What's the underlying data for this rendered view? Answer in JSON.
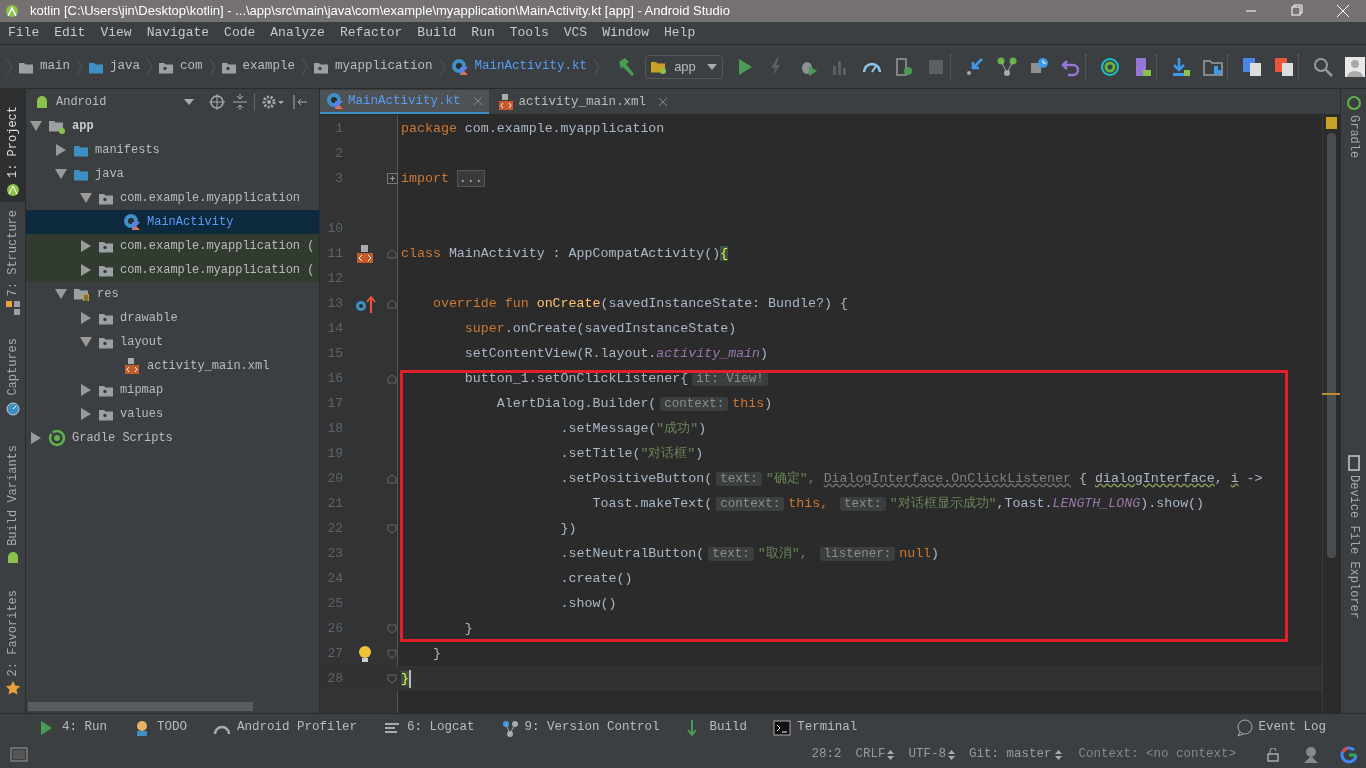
{
  "window": {
    "title": "kotlin [C:\\Users\\jin\\Desktop\\kotlin] - ...\\app\\src\\main\\java\\com\\example\\myapplication\\MainActivity.kt [app] - Android Studio"
  },
  "menu": [
    "File",
    "Edit",
    "View",
    "Navigate",
    "Code",
    "Analyze",
    "Refactor",
    "Build",
    "Run",
    "Tools",
    "VCS",
    "Window",
    "Help"
  ],
  "breadcrumb": [
    {
      "kind": "folder",
      "label": "main",
      "current": false
    },
    {
      "kind": "source",
      "label": "java",
      "current": false
    },
    {
      "kind": "package",
      "label": "com",
      "current": false
    },
    {
      "kind": "package",
      "label": "example",
      "current": false
    },
    {
      "kind": "package",
      "label": "myapplication",
      "current": false
    },
    {
      "kind": "kotlin",
      "label": "MainActivity.kt",
      "current": true
    }
  ],
  "run_config": {
    "label": "app"
  },
  "left_tool_tabs": [
    {
      "kind": "project",
      "label": "1: Project",
      "selected": true
    },
    {
      "kind": "structure",
      "label": "7: Structure",
      "selected": false
    },
    {
      "kind": "captures",
      "label": "Captures",
      "selected": false
    },
    {
      "kind": "variants",
      "label": "Build Variants",
      "selected": false
    },
    {
      "kind": "favorites",
      "label": "2: Favorites",
      "selected": false
    }
  ],
  "right_tool_tabs": [
    {
      "kind": "gradle",
      "label": "Gradle"
    },
    {
      "kind": "device",
      "label": "Device File Explorer"
    }
  ],
  "project": {
    "view": "Android",
    "tree": [
      {
        "kind": "module",
        "label": "app",
        "expanded": true,
        "selected": false,
        "highlighted": false,
        "children": [
          {
            "kind": "source",
            "label": "manifests",
            "expanded": false,
            "selected": false,
            "highlighted": false
          },
          {
            "kind": "source",
            "label": "java",
            "expanded": true,
            "selected": false,
            "highlighted": false,
            "children": [
              {
                "kind": "package",
                "label": "com.example.myapplication",
                "expanded": true,
                "selected": false,
                "highlighted": false,
                "children": [
                  {
                    "kind": "kotlin",
                    "label": "MainActivity",
                    "selected": true,
                    "highlighted": false
                  }
                ]
              },
              {
                "kind": "package",
                "label": "com.example.myapplication (",
                "expanded": false,
                "selected": false,
                "highlighted": true
              },
              {
                "kind": "package",
                "label": "com.example.myapplication (",
                "expanded": false,
                "selected": false,
                "highlighted": true
              }
            ]
          },
          {
            "kind": "res",
            "label": "res",
            "expanded": true,
            "selected": false,
            "highlighted": false,
            "children": [
              {
                "kind": "package",
                "label": "drawable",
                "expanded": false,
                "selected": false,
                "highlighted": false
              },
              {
                "kind": "package",
                "label": "layout",
                "expanded": true,
                "selected": false,
                "highlighted": false,
                "children": [
                  {
                    "kind": "xml",
                    "label": "activity_main.xml",
                    "selected": false,
                    "highlighted": false
                  }
                ]
              },
              {
                "kind": "package",
                "label": "mipmap",
                "expanded": false,
                "selected": false,
                "highlighted": false
              },
              {
                "kind": "package",
                "label": "values",
                "expanded": false,
                "selected": false,
                "highlighted": false
              }
            ]
          }
        ]
      },
      {
        "kind": "gradle",
        "label": "Gradle Scripts",
        "expanded": false,
        "selected": false,
        "highlighted": false
      }
    ]
  },
  "editor_tabs": [
    {
      "kind": "kotlin",
      "label": "MainActivity.kt",
      "selected": true
    },
    {
      "kind": "xml",
      "label": "activity_main.xml",
      "selected": false
    }
  ],
  "code": [
    {
      "number": "1",
      "tokens": [
        {
          "kind": "kw",
          "text": "package"
        },
        {
          "kind": "plain",
          "text": " com.example.myapplication"
        }
      ]
    },
    {
      "number": "2"
    },
    {
      "number": "3",
      "fold": {
        "kind": "collapsed"
      },
      "tokens": [
        {
          "kind": "kw",
          "text": "import "
        },
        {
          "kind": "folded",
          "text": "..."
        }
      ]
    },
    {
      "number": "10"
    },
    {
      "number": "11",
      "gutter_icon": {
        "kind": "layout"
      },
      "fold": {
        "kind": "start"
      },
      "tokens": [
        {
          "kind": "kw",
          "text": "class"
        },
        {
          "kind": "plain",
          "text": " MainActivity : AppCompatActivity()"
        },
        {
          "kind": "brace",
          "text": "{"
        }
      ]
    },
    {
      "number": "12"
    },
    {
      "number": "13",
      "gutter_icon": {
        "kind": "override"
      },
      "fold": {
        "kind": "start"
      },
      "tokens": [
        {
          "kind": "kw",
          "text": "    override fun "
        },
        {
          "kind": "fn",
          "text": "onCreate"
        },
        {
          "kind": "plain",
          "text": "(savedInstanceState: Bundle?) {"
        }
      ]
    },
    {
      "number": "14",
      "tokens": [
        {
          "kind": "kw",
          "text": "        super"
        },
        {
          "kind": "plain",
          "text": ".onCreate(savedInstanceState)"
        }
      ]
    },
    {
      "number": "15",
      "tokens": [
        {
          "kind": "plain",
          "text": "        setContentView(R.layout."
        },
        {
          "kind": "const",
          "text": "activity_main"
        },
        {
          "kind": "plain",
          "text": ")"
        }
      ]
    },
    {
      "number": "16",
      "fold": {
        "kind": "start"
      },
      "tokens": [
        {
          "kind": "plain",
          "text": "        button_1.setOnClickListener{"
        },
        {
          "kind": "hint",
          "text": "it: View!"
        }
      ]
    },
    {
      "number": "17",
      "tokens": [
        {
          "kind": "plain",
          "text": "            AlertDialog.Builder("
        },
        {
          "kind": "hint",
          "text": "context:"
        },
        {
          "kind": "kw",
          "text": "this"
        },
        {
          "kind": "plain",
          "text": ")"
        }
      ]
    },
    {
      "number": "18",
      "tokens": [
        {
          "kind": "plain",
          "text": "                    .setMessage("
        },
        {
          "kind": "str",
          "text": "\"成功\""
        },
        {
          "kind": "plain",
          "text": ")"
        }
      ]
    },
    {
      "number": "19",
      "tokens": [
        {
          "kind": "plain",
          "text": "                    .setTitle("
        },
        {
          "kind": "str",
          "text": "\"对话框\""
        },
        {
          "kind": "plain",
          "text": ")"
        }
      ]
    },
    {
      "number": "20",
      "fold": {
        "kind": "start"
      },
      "tokens": [
        {
          "kind": "plain",
          "text": "                    .setPositiveButton("
        },
        {
          "kind": "hint",
          "text": "text:"
        },
        {
          "kind": "str",
          "text": "\"确定\", "
        },
        {
          "kind": "dim",
          "text": "DialogInterface.OnClickListener"
        },
        {
          "kind": "plain",
          "text": " { "
        },
        {
          "kind": "warn",
          "text": "dialogInterface"
        },
        {
          "kind": "plain",
          "text": ", "
        },
        {
          "kind": "warn",
          "text": "i"
        },
        {
          "kind": "plain",
          "text": " ->"
        }
      ]
    },
    {
      "number": "21",
      "tokens": [
        {
          "kind": "plain",
          "text": "                        Toast.makeText("
        },
        {
          "kind": "hint",
          "text": "context:"
        },
        {
          "kind": "kw",
          "text": "this, "
        },
        {
          "kind": "hint",
          "text": "text:"
        },
        {
          "kind": "str",
          "text": "\"对话框显示成功\""
        },
        {
          "kind": "plain",
          "text": ",Toast."
        },
        {
          "kind": "const",
          "text": "LENGTH_LONG"
        },
        {
          "kind": "plain",
          "text": ").show()"
        }
      ]
    },
    {
      "number": "22",
      "fold": {
        "kind": "end"
      },
      "tokens": [
        {
          "kind": "plain",
          "text": "                    })"
        }
      ]
    },
    {
      "number": "23",
      "tokens": [
        {
          "kind": "plain",
          "text": "                    .setNeutralButton("
        },
        {
          "kind": "hint",
          "text": "text:"
        },
        {
          "kind": "str",
          "text": "\"取消\", "
        },
        {
          "kind": "hint",
          "text": "listener:"
        },
        {
          "kind": "kw",
          "text": "null"
        },
        {
          "kind": "plain",
          "text": ")"
        }
      ]
    },
    {
      "number": "24",
      "tokens": [
        {
          "kind": "plain",
          "text": "                    .create()"
        }
      ]
    },
    {
      "number": "25",
      "tokens": [
        {
          "kind": "plain",
          "text": "                    .show()"
        }
      ]
    },
    {
      "number": "26",
      "fold": {
        "kind": "end"
      },
      "tokens": [
        {
          "kind": "plain",
          "text": "        }"
        }
      ]
    },
    {
      "number": "27",
      "gutter_icon": {
        "kind": "bulb"
      },
      "fold": {
        "kind": "end"
      },
      "tokens": [
        {
          "kind": "plain",
          "text": "    }"
        }
      ]
    },
    {
      "number": "28",
      "fold": {
        "kind": "end"
      },
      "current": true,
      "tokens": [
        {
          "kind": "brace",
          "text": "}"
        }
      ]
    }
  ],
  "annotation": {
    "kind": "rectangle",
    "color": "#e3202a"
  },
  "bottom_tools": [
    {
      "kind": "run",
      "label": "4: Run"
    },
    {
      "kind": "todo",
      "label": "TODO"
    },
    {
      "kind": "profiler",
      "label": "Android Profiler"
    },
    {
      "kind": "logcat",
      "label": "6: Logcat"
    },
    {
      "kind": "vcs",
      "label": "9: Version Control"
    },
    {
      "kind": "build",
      "label": "Build"
    },
    {
      "kind": "terminal",
      "label": "Terminal"
    }
  ],
  "event_log": "Event Log",
  "status_bar": {
    "position": "28:2",
    "line_separator": "CRLF",
    "encoding": "UTF-8",
    "git": "Git: master",
    "context": "Context: <no context>"
  }
}
